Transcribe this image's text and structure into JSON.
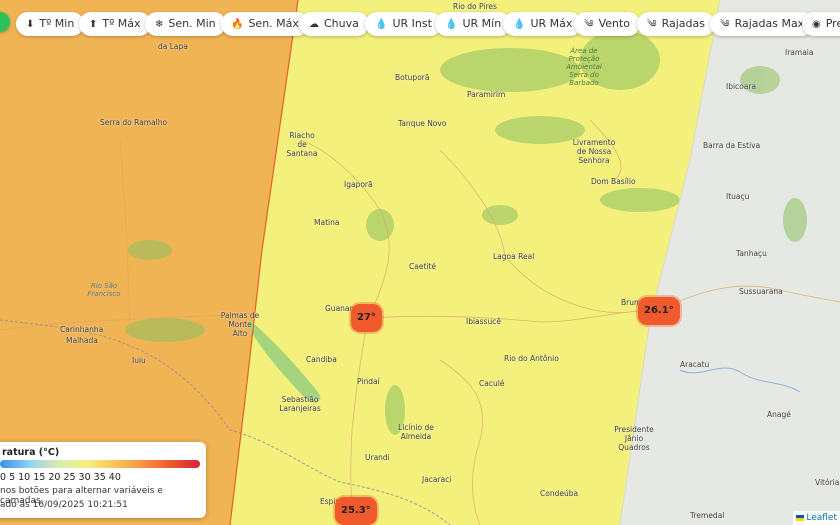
{
  "toolbar": {
    "buttons": [
      {
        "icon": "⬇",
        "label": "Tº Min"
      },
      {
        "icon": "⬆",
        "label": "Tº Máx"
      },
      {
        "icon": "❄",
        "label": "Sen. Min"
      },
      {
        "icon": "🔥",
        "label": "Sen. Máx"
      },
      {
        "icon": "☁",
        "label": "Chuva"
      },
      {
        "icon": "💧",
        "label": "UR Inst"
      },
      {
        "icon": "💧",
        "label": "UR Mín"
      },
      {
        "icon": "💧",
        "label": "UR Máx"
      },
      {
        "icon": "༄",
        "label": "Vento"
      },
      {
        "icon": "༄",
        "label": "Rajadas"
      },
      {
        "icon": "༄",
        "label": "Rajadas Max"
      },
      {
        "icon": "◉",
        "label": "Pre"
      }
    ]
  },
  "places": [
    "Rio do Pires",
    "da Lapa",
    "Serra do Ramalho",
    "Riacho de Santana",
    "Botuporã",
    "Paramirim",
    "Tanque Novo",
    "Igaporã",
    "Matina",
    "Caetité",
    "Lagoa Real",
    "Livramento de Nossa Senhora",
    "Dom Basílio",
    "Barra da Estiva",
    "Ibicoara",
    "Iramaia",
    "Ituaçu",
    "Tanhaçu",
    "Sussuarana",
    "Guanambi",
    "Ibiassucê",
    "Rio do Antônio",
    "Palmas de Monte Alto",
    "Carinhanha",
    "Malhada",
    "Iuiu",
    "Candiba",
    "Pindaí",
    "Sebastião Laranjeiras",
    "Caculé",
    "Licínio de Almeida",
    "Urandi",
    "Jacaraci",
    "Condeúba",
    "Espinosa",
    "Presidente Jânio Quadros",
    "Aracatu",
    "Anagé",
    "Tremedal",
    "Vitória",
    "Brumado"
  ],
  "rivers": [
    "Rio São Francisco"
  ],
  "parks": [
    "Área de Proteção Ambiental Serra do Barbado"
  ],
  "markers": [
    {
      "value": "27°",
      "color": "#f05a2c"
    },
    {
      "value": "26.1°",
      "color": "#f05a2c"
    },
    {
      "value": "25.3°",
      "color": "#f05a2c"
    }
  ],
  "legend": {
    "title": "ratura (°C)",
    "scale": "0 5 10 15 20 25 30 35 40",
    "hint": "nos botões para alternar variáveis e camadas.",
    "updated": "ado às 16/09/2025 10:21:51"
  },
  "attribution": "Leaflet",
  "colors": {
    "zone_orange": "#f1b454",
    "zone_yellow": "#f3f07c",
    "zone_gray": "#e6e8e3",
    "marker": "#f05a2c"
  }
}
